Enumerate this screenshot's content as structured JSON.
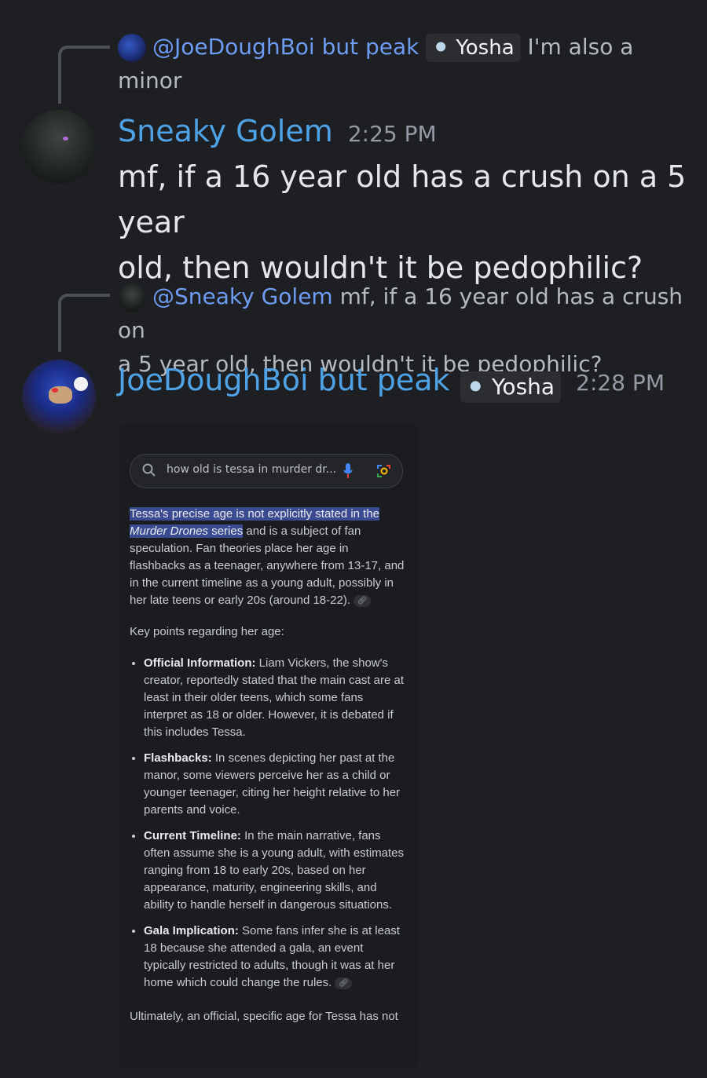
{
  "msg1_reply": {
    "mention": "@JoeDoughBoi but peak",
    "tag": "Yosha",
    "tag_icon": "yosha-badge-icon",
    "text_a": "I'm also a",
    "text_b": "minor"
  },
  "msg1": {
    "author": "Sneaky Golem",
    "time": "2:25 PM",
    "line1": "mf, if a 16 year old has a crush on a 5 year",
    "line2": "old, then wouldn't it be pedophilic?"
  },
  "msg2_reply": {
    "mention": "@Sneaky Golem",
    "text_a": "mf, if a 16 year old has a crush on",
    "text_b": "a 5 year old, then wouldn't it be pedophilic?"
  },
  "msg2": {
    "author": "JoeDoughBoi but peak",
    "tag": "Yosha",
    "time": "2:28 PM"
  },
  "screenshot": {
    "search_text": "how old is tessa in murder dr...",
    "p1_hl1": "Tessa's precise age is not explicitly stated in the",
    "p1_hl2_italic": "Murder Drones",
    "p1_hl2_rest": " series",
    "p1_rest1": " and is a subject of fan",
    "p1_rest2": "speculation. Fan theories place her age in",
    "p1_rest3": "flashbacks as a teenager, anywhere from 13-17, and",
    "p1_rest4": "in the current timeline as a young adult, possibly in",
    "p1_rest5": "her late teens or early 20s (around 18-22).",
    "key_points": "Key points regarding her age:",
    "bullets": [
      {
        "title": "Official Information:",
        "text": " Liam Vickers, the show's creator, reportedly stated that the main cast are at least in their older teens, which some fans interpret as 18 or older. However, it is debated if this includes Tessa."
      },
      {
        "title": "Flashbacks:",
        "text": " In scenes depicting her past at the manor, some viewers perceive her as a child or younger teenager, citing her height relative to her parents and voice."
      },
      {
        "title": "Current Timeline:",
        "text": " In the main narrative, fans often assume she is a young adult, with estimates ranging from 18 to early 20s, based on her appearance, maturity, engineering skills, and ability to handle herself in dangerous situations."
      },
      {
        "title": "Gala Implication:",
        "text": " Some fans infer she is at least 18 because she attended a gala, an event typically restricted to adults, though it was at her home which could change the rules."
      }
    ],
    "ultimately": "Ultimately, an official, specific age for Tessa has not"
  }
}
